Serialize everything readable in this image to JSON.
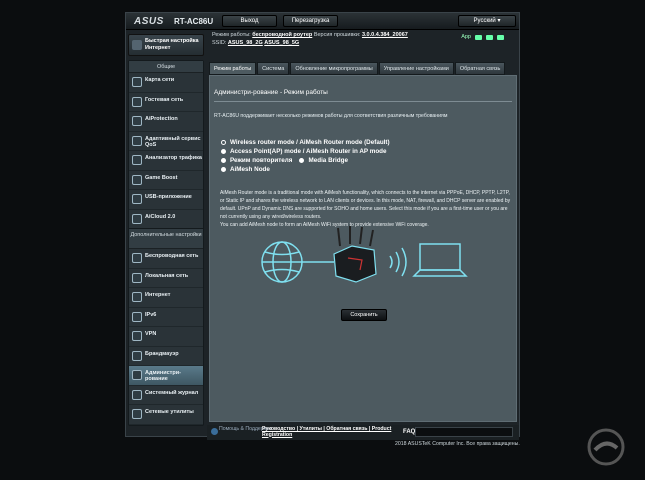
{
  "header": {
    "logo": "ASUS",
    "model": "RT-AC86U",
    "logout": "Выход",
    "reboot": "Перезагрузка",
    "language": "Русский"
  },
  "info": {
    "mode_label": "Режим работы:",
    "mode_value": "беспроводной роутер",
    "fw_label": "Версия прошивки:",
    "fw_value": "3.0.0.4.384_20067",
    "ssid_label": "SSID:",
    "ssid_1": "ASUS_98_2G",
    "ssid_2": "ASUS_98_5G",
    "app_label": "App"
  },
  "sidebar": {
    "quick_setup": "Быстрая настройка Интернет",
    "general_title": "Общие",
    "general_items": [
      {
        "label": "Карта сети",
        "icon": "network-map-icon"
      },
      {
        "label": "Гостевая сеть",
        "icon": "guest-network-icon"
      },
      {
        "label": "AiProtection",
        "icon": "aiprotection-icon"
      },
      {
        "label": "Адаптивный сервис QoS",
        "icon": "qos-icon"
      },
      {
        "label": "Анализатор трафика",
        "icon": "traffic-analyzer-icon"
      },
      {
        "label": "Game Boost",
        "icon": "game-boost-icon"
      },
      {
        "label": "USB-приложение",
        "icon": "usb-app-icon"
      },
      {
        "label": "AiCloud 2.0",
        "icon": "aicloud-icon"
      }
    ],
    "advanced_title": "Дополнительные настройки",
    "advanced_items": [
      {
        "label": "Беспроводная сеть",
        "icon": "wireless-icon"
      },
      {
        "label": "Локальная сеть",
        "icon": "lan-icon"
      },
      {
        "label": "Интернет",
        "icon": "wan-icon"
      },
      {
        "label": "IPv6",
        "icon": "ipv6-icon"
      },
      {
        "label": "VPN",
        "icon": "vpn-icon"
      },
      {
        "label": "Брандмауэр",
        "icon": "firewall-icon"
      },
      {
        "label": "Администри-рование",
        "icon": "admin-icon",
        "active": true
      },
      {
        "label": "Системный журнал",
        "icon": "syslog-icon"
      },
      {
        "label": "Сетевые утилиты",
        "icon": "network-tools-icon"
      }
    ]
  },
  "tabs": [
    "Режим работы",
    "Система",
    "Обновление микропрограммы",
    "Управление настройками",
    "Обратная связь"
  ],
  "panel": {
    "title": "Администри-рование - Режим работы",
    "description": "RT-AC86U поддерживает несколько режимов работы для соответствия различным требованиям",
    "options": [
      "Wireless router mode / AiMesh Router mode (Default)",
      "Access Point(AP) mode / AiMesh Router in AP mode",
      "Режим повторителя",
      "Media Bridge",
      "AiMesh Node"
    ],
    "paragraph_1": "AiMesh Router mode is a traditional mode with AiMesh functionality, which connects to the internet via PPPoE, DHCP, PPTP, L2TP, or Static IP and shares the wireless network to LAN clients or devices. In this mode, NAT, firewall, and DHCP server are enabled by default. UPnP and Dynamic DNS are supported for SOHO and home users. Select this mode if you are a first-time user or you are not currently using any wired/wireless routers.",
    "paragraph_2": "You can add AiMesh node to form an AiMesh WiFi system to provide extensive WiFi coverage.",
    "save": "Сохранить"
  },
  "footer": {
    "help": "Помощь & Поддержка",
    "links": "Руководство | Утилиты | Обратная связь | Product Registration",
    "faq": "FAQ",
    "copyright": "2018 ASUSTeK Computer Inc. Все права защищены."
  },
  "colors": {
    "panel_bg": "#4d5a60",
    "frame_bg": "#1d2327",
    "active_item": "#5a7a8a",
    "diagram_stroke": "#7fe0f0"
  }
}
